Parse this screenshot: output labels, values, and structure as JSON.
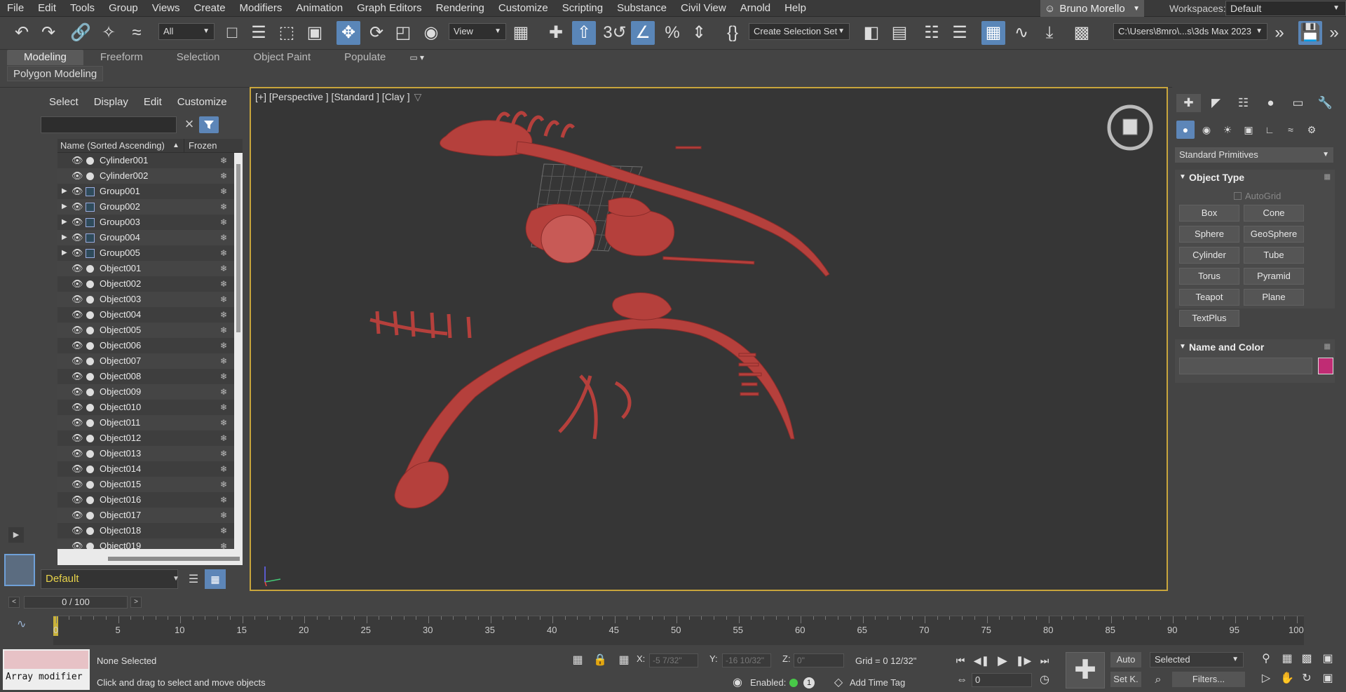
{
  "menu": [
    "File",
    "Edit",
    "Tools",
    "Group",
    "Views",
    "Create",
    "Modifiers",
    "Animation",
    "Graph Editors",
    "Rendering",
    "Customize",
    "Scripting",
    "Substance",
    "Civil View",
    "Arnold",
    "Help"
  ],
  "user": {
    "name": "Bruno Morello"
  },
  "workspaces": {
    "label": "Workspaces:",
    "value": "Default"
  },
  "toolbar": {
    "selection_filter": "All",
    "reference_coord": "View",
    "named_selection": "Create Selection Set",
    "project_path": "C:\\Users\\8mro\\...s\\3ds Max 2023"
  },
  "ribbon": {
    "tabs": [
      "Modeling",
      "Freeform",
      "Selection",
      "Object Paint",
      "Populate"
    ],
    "active": "Modeling",
    "sub": "Polygon Modeling"
  },
  "explorer": {
    "menu": [
      "Select",
      "Display",
      "Edit",
      "Customize"
    ],
    "col_name": "Name (Sorted Ascending)",
    "col_frozen": "Frozen",
    "rows": [
      {
        "name": "Cylinder001",
        "group": false
      },
      {
        "name": "Cylinder002",
        "group": false
      },
      {
        "name": "Group001",
        "group": true
      },
      {
        "name": "Group002",
        "group": true
      },
      {
        "name": "Group003",
        "group": true
      },
      {
        "name": "Group004",
        "group": true
      },
      {
        "name": "Group005",
        "group": true
      },
      {
        "name": "Object001",
        "group": false
      },
      {
        "name": "Object002",
        "group": false
      },
      {
        "name": "Object003",
        "group": false
      },
      {
        "name": "Object004",
        "group": false
      },
      {
        "name": "Object005",
        "group": false
      },
      {
        "name": "Object006",
        "group": false
      },
      {
        "name": "Object007",
        "group": false
      },
      {
        "name": "Object008",
        "group": false
      },
      {
        "name": "Object009",
        "group": false
      },
      {
        "name": "Object010",
        "group": false
      },
      {
        "name": "Object011",
        "group": false
      },
      {
        "name": "Object012",
        "group": false
      },
      {
        "name": "Object013",
        "group": false
      },
      {
        "name": "Object014",
        "group": false
      },
      {
        "name": "Object015",
        "group": false
      },
      {
        "name": "Object016",
        "group": false
      },
      {
        "name": "Object017",
        "group": false
      },
      {
        "name": "Object018",
        "group": false
      },
      {
        "name": "Object019",
        "group": false
      }
    ],
    "layer": "Default"
  },
  "viewport": {
    "label": "[+] [Perspective ] [Standard ] [Clay ]",
    "mesh_color": "#b5403c"
  },
  "command_panel": {
    "category": "Standard Primitives",
    "object_type_title": "Object Type",
    "autogrid": "AutoGrid",
    "buttons": [
      "Box",
      "Cone",
      "Sphere",
      "GeoSphere",
      "Cylinder",
      "Tube",
      "Torus",
      "Pyramid",
      "Teapot",
      "Plane",
      "TextPlus"
    ],
    "name_color_title": "Name and Color",
    "object_color": "#c02c74"
  },
  "timeline": {
    "slider": "0 / 100",
    "labels": [
      "0",
      "5",
      "10",
      "15",
      "20",
      "25",
      "30",
      "35",
      "40",
      "45",
      "50",
      "55",
      "60",
      "65",
      "70",
      "75",
      "80",
      "85",
      "90",
      "95",
      "100"
    ]
  },
  "status": {
    "maxscript": "Array modifier",
    "selection": "None Selected",
    "prompt": "Click and drag to select and move objects",
    "x_label": "X:",
    "x_value": "-5 7/32\"",
    "y_label": "Y:",
    "y_value": "-16 10/32\"",
    "z_label": "Z:",
    "z_value": "0\"",
    "grid": "Grid = 0 12/32\"",
    "enabled": "Enabled:",
    "enabled_count": "1",
    "add_time_tag": "Add Time Tag",
    "frame": "0",
    "auto": "Auto",
    "set_key": "Set K.",
    "key_filter": "Selected",
    "filters": "Filters..."
  }
}
